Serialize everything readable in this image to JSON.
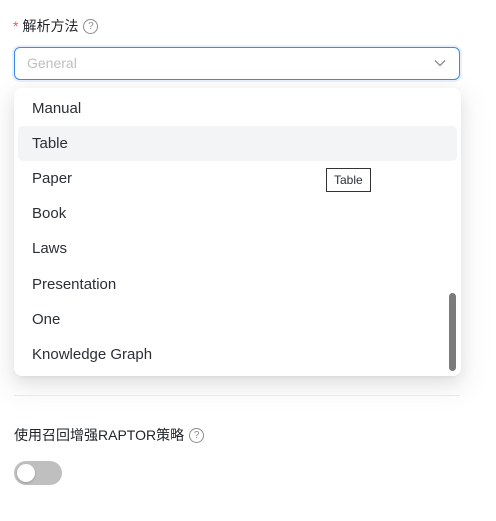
{
  "parse_method": {
    "required_mark": "*",
    "label": "解析方法",
    "help_icon": "question-circle-icon",
    "placeholder": "General",
    "chevron_icon": "chevron-down-icon",
    "options": [
      "Manual",
      "Table",
      "Paper",
      "Book",
      "Laws",
      "Presentation",
      "One",
      "Knowledge Graph"
    ],
    "hovered_option": "Table",
    "tooltip": "Table"
  },
  "raptor": {
    "label": "使用召回增强RAPTOR策略",
    "help_icon": "question-circle-icon",
    "toggle_on": false
  },
  "colors": {
    "focus_border": "#3d8be8",
    "required": "#ff4d4f",
    "toggle_off": "#bfbfbf",
    "hover_bg": "#f3f4f6"
  }
}
